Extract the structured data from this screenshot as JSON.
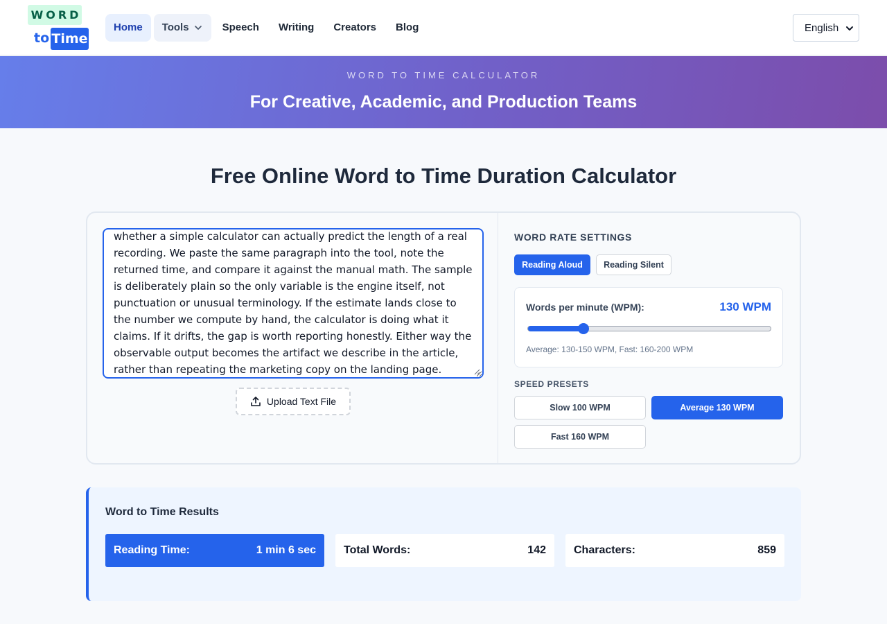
{
  "logo": {
    "word": "WORD",
    "to": "to",
    "time": "Time"
  },
  "nav": {
    "home": "Home",
    "tools": "Tools",
    "speech": "Speech",
    "writing": "Writing",
    "creators": "Creators",
    "blog": "Blog"
  },
  "language": {
    "selected": "English"
  },
  "banner": {
    "subtitle": "WORD TO TIME CALCULATOR",
    "title": "For Creative, Academic, and Production Teams"
  },
  "page_title": "Free Online Word to Time Duration Calculator",
  "editor": {
    "text": "whether a simple calculator can actually predict the length of a real recording. We paste the same paragraph into the tool, note the returned time, and compare it against the manual math. The sample is deliberately plain so the only variable is the engine itself, not punctuation or unusual terminology. If the estimate lands close to the number we compute by hand, the calculator is doing what it claims. If it drifts, the gap is worth reporting honestly. Either way the observable output becomes the artifact we describe in the article, rather than repeating the marketing copy on the landing page.",
    "upload_label": "Upload Text File"
  },
  "settings": {
    "heading": "WORD RATE SETTINGS",
    "mode_aloud": "Reading Aloud",
    "mode_silent": "Reading Silent",
    "wpm_label": "Words per minute (WPM):",
    "wpm_value": "130 WPM",
    "slider": {
      "min": 50,
      "max": 400,
      "value": 130
    },
    "wpm_hint": "Average: 130-150 WPM, Fast: 160-200 WPM",
    "presets_heading": "SPEED PRESETS",
    "preset_slow": "Slow 100 WPM",
    "preset_average": "Average 130 WPM",
    "preset_fast": "Fast 160 WPM"
  },
  "results": {
    "title": "Word to Time Results",
    "reading_time_label": "Reading Time:",
    "reading_time_value": "1 min 6 sec",
    "total_words_label": "Total Words:",
    "total_words_value": "142",
    "characters_label": "Characters:",
    "characters_value": "859"
  },
  "colors": {
    "accent": "#2563eb",
    "banner_start": "#667eea",
    "banner_end": "#7c4dab"
  }
}
